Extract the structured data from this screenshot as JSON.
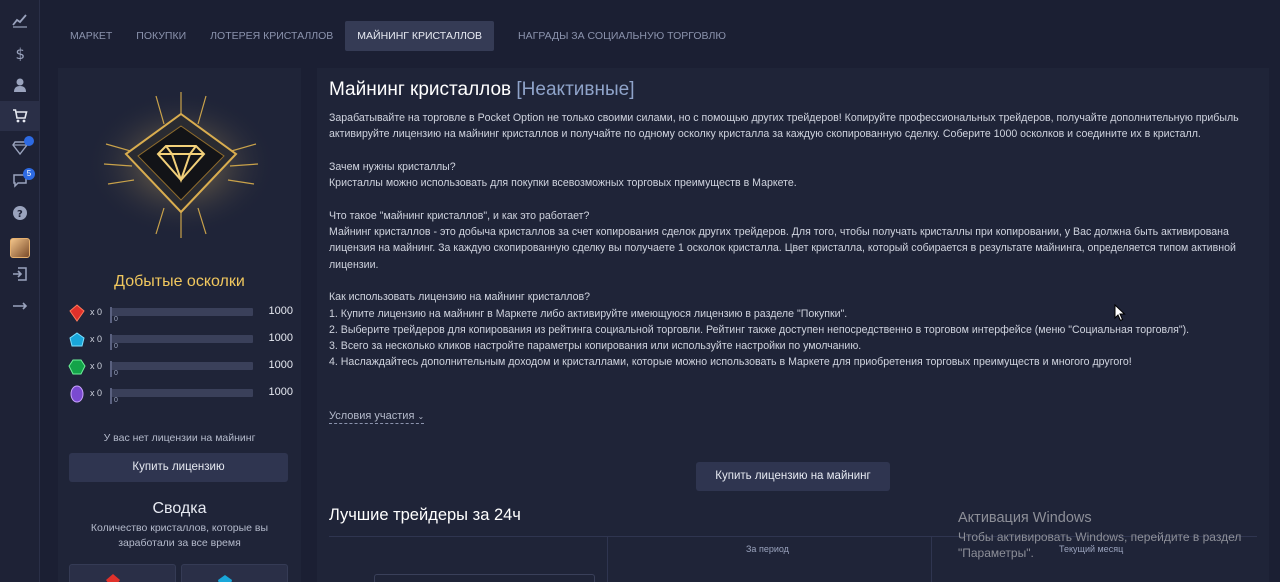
{
  "sidebar": {
    "icons": [
      "chart-line-icon",
      "dollar-icon",
      "user-icon",
      "cart-icon",
      "diamond-icon",
      "chat-icon",
      "help-icon",
      "avatar",
      "logout-icon",
      "arrow-right-icon"
    ],
    "diamond_badge": "",
    "chat_badge": "5"
  },
  "tabs": [
    "МАРКЕТ",
    "ПОКУПКИ",
    "ЛОТЕРЕЯ КРИСТАЛЛОВ",
    "МАЙНИНГ КРИСТАЛЛОВ",
    "НАГРАДЫ ЗА СОЦИАЛЬНУЮ ТОРГОВЛЮ"
  ],
  "active_tab": "МАЙНИНГ КРИСТАЛЛОВ",
  "left": {
    "shards_title": "Добытые осколки",
    "shards": [
      {
        "gem": "red",
        "count": "x 0",
        "zero": "0",
        "max": "1000",
        "progress": 0
      },
      {
        "gem": "blue",
        "count": "x 0",
        "zero": "0",
        "max": "1000",
        "progress": 0
      },
      {
        "gem": "green",
        "count": "x 0",
        "zero": "0",
        "max": "1000",
        "progress": 0
      },
      {
        "gem": "purple",
        "count": "x 0",
        "zero": "0",
        "max": "1000",
        "progress": 0
      }
    ],
    "no_license": "У вас нет лицензии на майнинг",
    "buy_license": "Купить лицензию",
    "summary_title": "Сводка",
    "summary_sub": "Количество кристаллов, которые вы заработали за все время"
  },
  "main": {
    "title": "Майнинг кристаллов",
    "status": "[Неактивные]",
    "paragraphs": [
      [
        "Зарабатывайте на торговле в Pocket Option не только своими силами, но с помощью других трейдеров! Копируйте профессиональных трейдеров, получайте дополнительную прибыль активируйте лицензию на майнинг кристаллов и получайте по одному осколку кристалла за каждую скопированную сделку. Соберите 1000 осколков и соедините их в кристалл."
      ],
      [
        "Зачем нужны кристаллы?",
        "Кристаллы можно использовать для покупки всевозможных торговых преимуществ в Маркете."
      ],
      [
        "Что такое \"майнинг кристаллов\", и как это работает?",
        "Майнинг кристаллов - это добыча кристаллов за счет копирования сделок других трейдеров. Для того, чтобы получать кристаллы при копировании, у Вас должна быть активирована лицензия на майнинг. За каждую скопированную сделку вы получаете 1 осколок кристалла. Цвет кристалла, который собирается в результате майнинга, определяется типом активной лицензии."
      ],
      [
        "Как использовать лицензию на майнинг кристаллов?",
        "1. Купите лицензию на майнинг в Маркете либо активируйте имеющуюся лицензию в разделе \"Покупки\".",
        "2. Выберите трейдеров для копирования из рейтинга социальной торговли. Рейтинг также доступен непосредственно в торговом интерфейсе (меню \"Социальная торговля\").",
        "3. Всего за несколько кликов настройте параметры копирования или используйте настройки по умолчанию.",
        "4. Наслаждайтесь дополнительным доходом и кристаллами, которые можно использовать в Маркете для приобретения торговых преимуществ и многого другого!"
      ]
    ],
    "conditions_link": "Условия участия",
    "buy_mining": "Купить лицензию на майнинг",
    "best_title": "Лучшие трейдеры за 24ч",
    "col_period": "За период",
    "col_month": "Текущий месяц"
  },
  "watermark": {
    "title": "Активация Windows",
    "line1": "Чтобы активировать Windows, перейдите в раздел",
    "line2": "\"Параметры\"."
  },
  "colors": {
    "accent_gold": "#f0c75e",
    "status": "#8fa3c9",
    "bg": "#1b1f33",
    "panel": "#1f2438"
  }
}
